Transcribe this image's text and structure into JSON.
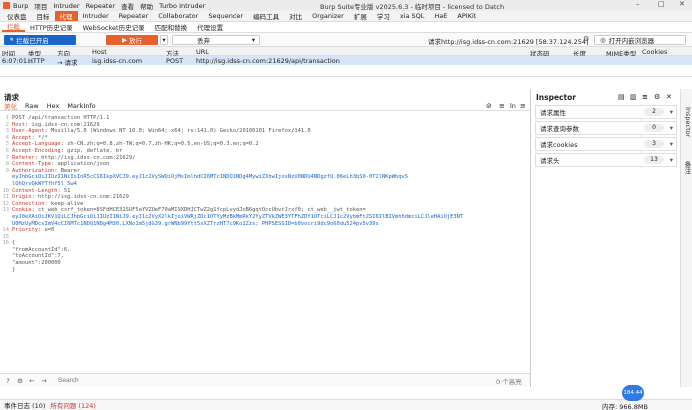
{
  "app": {
    "menu": [
      "Burp",
      "项目",
      "Intruder",
      "Repeater",
      "查看",
      "帮助",
      "Turbo Intruder"
    ],
    "title": "Burp Suite专业版  v2025.6.3 - 临时项目 - licensed to Datch",
    "window_controls": [
      "–",
      "□",
      "✕"
    ]
  },
  "main_tabs": {
    "items": [
      "仪表盘",
      "目标",
      "代理",
      "Intruder",
      "Repeater",
      "Collaborator",
      "Sequencer",
      "编码工具",
      "对比",
      "Organizer",
      "扩展",
      "学习",
      "xia SQL",
      "HaE",
      "APIKit"
    ],
    "active_index": 2
  },
  "sub_tabs": {
    "items": [
      "拦截",
      "HTTP历史记录",
      "WebSocket历史记录",
      "匹配和替换",
      "代理设置"
    ],
    "active_index": 0
  },
  "toolbar": {
    "intercept_label": "拦截已开启",
    "forward_label": "放行",
    "drop_label": "丢弃",
    "dropdown_value": "丢弃",
    "request_info": "请求http://isg.idss-cn.com:21629  [58.37.124.254]",
    "open_browser_label": "打开内嵌浏览器"
  },
  "history": {
    "columns": [
      "时间",
      "类型",
      "方向",
      "Host",
      "方法",
      "URL",
      "状态码",
      "长度",
      "MIME类型",
      "Cookies"
    ],
    "row": {
      "time": "6:07:01...",
      "type": "HTTP",
      "direction": "→ 请求",
      "host": "isg.idss-cn.com",
      "method": "POST",
      "url": "http://isg.idss-cn.com:21629/api/transaction"
    }
  },
  "request": {
    "title": "请求",
    "view_tabs": [
      "美化",
      "Raw",
      "Hex",
      "MarkInfo"
    ],
    "active_view": 0,
    "right_controls": [
      "eye-slash",
      "≡",
      "ln",
      "≡"
    ],
    "lines": [
      {
        "n": "1",
        "k": "",
        "v": "POST /api/transaction HTTP/1.1"
      },
      {
        "n": "2",
        "k": "Host",
        "v": ": isg.idss-cn.com:21629"
      },
      {
        "n": "3",
        "k": "User-Agent",
        "v": ": Mozilla/5.0 (Windows NT 10.0; Win64; x64; rv:141.0) Gecko/20100101 Firefox/141.0"
      },
      {
        "n": "4",
        "k": "Accept",
        "v": ": */*"
      },
      {
        "n": "5",
        "k": "Accept-Language",
        "v": ": zh-CN,zh;q=0.8,zh-TW;q=0.7,zh-HK;q=0.5,en-US;q=0.3,en;q=0.2"
      },
      {
        "n": "6",
        "k": "Accept-Encoding",
        "v": ": gzip, deflate, br"
      },
      {
        "n": "7",
        "k": "Referer",
        "v": ": http://isg.idss-cn.com:21629/"
      },
      {
        "n": "8",
        "k": "Content-Type",
        "v": ": application/json"
      },
      {
        "n": "9",
        "k": "Authorization",
        "v": ": Bearer"
      },
      {
        "n": "",
        "k": "",
        "v": "eyJhbGciOiJIUzI1NiIsInR5cCI6IkpXVCJ9.eyJ1c2VySWQiOjMsImlhdCI6MTc1NDQ1NDg4MywiZXhwIjoxNzU0NDU4NDgzfQ.06eLh3bS0-0T2lNKpWbqvS"
      },
      {
        "n": "",
        "k": "",
        "v": "lQhQrvQkWYTfhf5l_5w4"
      },
      {
        "n": "10",
        "k": "Content-Length",
        "v": ": 51"
      },
      {
        "n": "11",
        "k": "Origin",
        "v": ": http://isg.idss-cn.com:21629"
      },
      {
        "n": "12",
        "k": "Connection",
        "v": ": keep-alive"
      },
      {
        "n": "13",
        "k": "Cookie",
        "v": ": ct_web_csrf_token=8SFdHCE31SUF5aYVZUeF70aMI9XDHJCTwZ2g1fcpLvydJxB6gqtQccUbvtJrxf0; ct_web__jwt_token="
      },
      {
        "n": "",
        "k": "",
        "v": "eyJ0eXAiOiJKV1QiLCJhbGciOiJIUzI1NiJ9.eyJ1c2VyX2lkIjoiVWRjZDc1OTYyMzBkMmRkY2YyZTVkZWE3YTFhZDY1OTciLCJ1c2VybmFtZSI6IlBIVmhhdmciLCJleHAiOjE3NT"
      },
      {
        "n": "",
        "k": "",
        "v": "U0MzUyMDcsImV4cCI6MTc1NDQ1NDg4M30.LXNo1m5jdGJ9.grWNb99Ytt5xXZTrzHT7c9Ko1Zzs; PHPSESSID=b0vocri9dc9o60du524pv5v39s"
      },
      {
        "n": "14",
        "k": "Priority",
        "v": ": u=0"
      },
      {
        "n": "15",
        "k": "",
        "v": ""
      },
      {
        "n": "16",
        "k": "",
        "v": "{"
      },
      {
        "n": "",
        "k": "",
        "v": "  \"fromAccountId\":6,"
      },
      {
        "n": "",
        "k": "",
        "v": "  \"toAccountId\":7,"
      },
      {
        "n": "",
        "k": "",
        "v": "  \"amount\":200000"
      },
      {
        "n": "",
        "k": "",
        "v": "}"
      }
    ],
    "search_placeholder": "Search",
    "search_highlights": "0 个高亮"
  },
  "inspector": {
    "title": "Inspector",
    "rows": [
      {
        "label": "请求属性",
        "count": "2"
      },
      {
        "label": "请求查询参数",
        "count": "0"
      },
      {
        "label": "请求cookies",
        "count": "3"
      },
      {
        "label": "请求头",
        "count": "13"
      }
    ],
    "rail_tabs": [
      "Inspector",
      "备注"
    ]
  },
  "status": {
    "event_log": "事件日志 (10)",
    "all_issues": "所有问题 (124)",
    "memory": "内存: 966.8MB",
    "bubble": "184.44"
  }
}
